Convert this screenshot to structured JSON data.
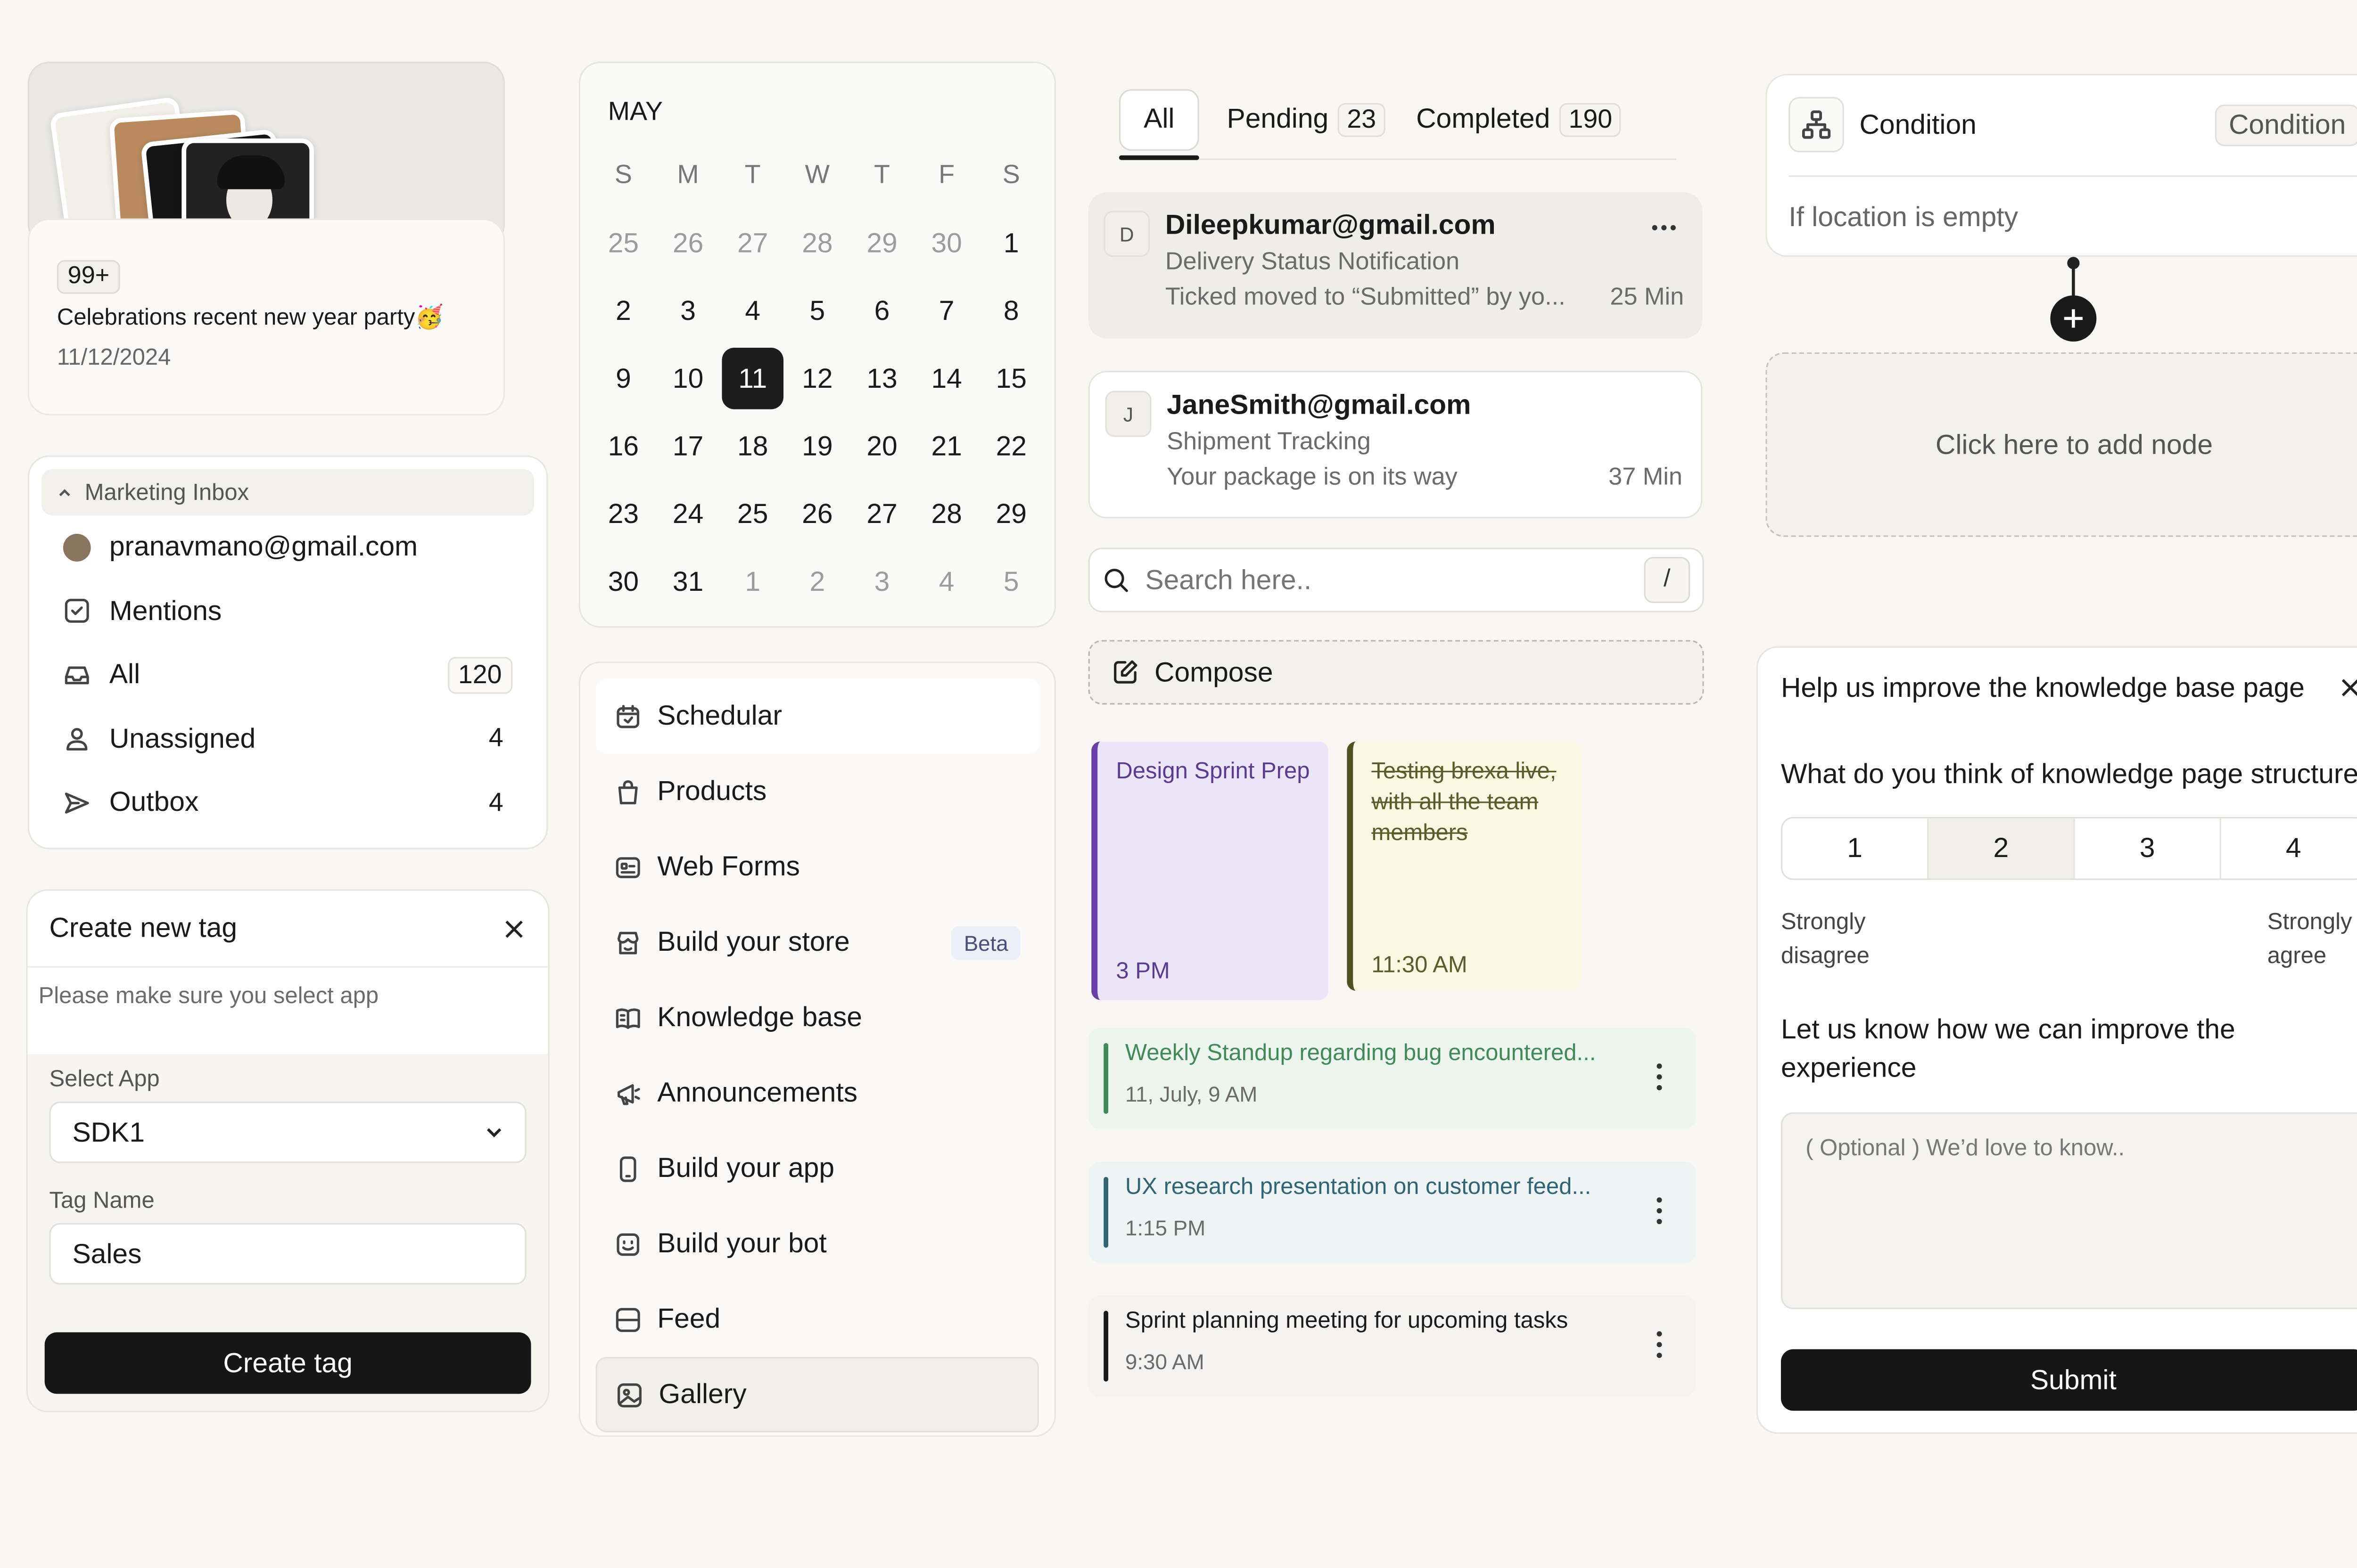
{
  "folder": {
    "badge": "99+",
    "title": "Celebrations recent new year party🥳",
    "date": "11/12/2024"
  },
  "inbox": {
    "header": "Marketing Inbox",
    "items": [
      {
        "label": "pranavmano@gmail.com",
        "count": ""
      },
      {
        "label": "Mentions",
        "count": ""
      },
      {
        "label": "All",
        "count": "120"
      },
      {
        "label": "Unassigned",
        "count": "4"
      },
      {
        "label": "Outbox",
        "count": "4"
      }
    ]
  },
  "tagform": {
    "title": "Create new tag",
    "hint": "Please make sure you select app",
    "app_label": "Select App",
    "app_value": "SDK1",
    "name_label": "Tag Name",
    "name_value": "Sales",
    "submit": "Create tag"
  },
  "calendar": {
    "month": "MAY",
    "weekdays": [
      "S",
      "M",
      "T",
      "W",
      "T",
      "F",
      "S"
    ],
    "weeks": [
      [
        "25",
        "26",
        "27",
        "28",
        "29",
        "30",
        "1"
      ],
      [
        "2",
        "3",
        "4",
        "5",
        "6",
        "7",
        "8"
      ],
      [
        "9",
        "10",
        "11",
        "12",
        "13",
        "14",
        "15"
      ],
      [
        "16",
        "17",
        "18",
        "19",
        "20",
        "21",
        "22"
      ],
      [
        "23",
        "24",
        "25",
        "26",
        "27",
        "28",
        "29"
      ],
      [
        "30",
        "31",
        "1",
        "2",
        "3",
        "4",
        "5"
      ]
    ],
    "selected": "11"
  },
  "menu": {
    "items": [
      {
        "label": "Schedular",
        "icon": "calendar-icon"
      },
      {
        "label": "Products",
        "icon": "bag-icon"
      },
      {
        "label": "Web Forms",
        "icon": "form-icon"
      },
      {
        "label": "Build your store",
        "icon": "store-icon",
        "badge": "Beta"
      },
      {
        "label": "Knowledge base",
        "icon": "book-icon"
      },
      {
        "label": "Announcements",
        "icon": "megaphone-icon"
      },
      {
        "label": "Build your app",
        "icon": "phone-icon"
      },
      {
        "label": "Build your bot",
        "icon": "bot-icon"
      },
      {
        "label": "Feed",
        "icon": "feed-icon"
      },
      {
        "label": "Gallery",
        "icon": "gallery-icon"
      }
    ]
  },
  "tabs": {
    "all": "All",
    "pending": "Pending",
    "pending_count": "23",
    "completed": "Completed",
    "completed_count": "190"
  },
  "mails": [
    {
      "avatar": "D",
      "from": "Dileepkumar@gmail.com",
      "subject": "Delivery Status Notification",
      "preview": "Ticked moved to “Submitted” by yo...",
      "time": "25 Min"
    },
    {
      "avatar": "J",
      "from": "JaneSmith@gmail.com",
      "subject": "Shipment Tracking",
      "preview": "Your package is on its way",
      "time": "37 Min"
    }
  ],
  "search": {
    "placeholder": "Search here..",
    "shortcut": "/"
  },
  "compose": {
    "label": "Compose"
  },
  "notes": [
    {
      "text": "Design Sprint Prep",
      "time": "3 PM"
    },
    {
      "text": "Testing brexa live, with all the team members",
      "time": "11:30 AM"
    }
  ],
  "events": [
    {
      "title": "Weekly Standup regarding bug encountered...",
      "time": "11, July, 9 AM",
      "color": "#3f8a57"
    },
    {
      "title": "UX research presentation on customer feed...",
      "time": "1:15 PM",
      "color": "#2f6474"
    },
    {
      "title": "Sprint planning meeting for upcoming tasks",
      "time": "9:30 AM",
      "color": "#1a1a1a"
    }
  ],
  "condition": {
    "label": "Condition",
    "pill": "Condition",
    "rule": "If location is empty",
    "add": "Click here to add node"
  },
  "feedback": {
    "title": "Help us improve the knowledge base page",
    "question1": "What do you think of knowledge page structure",
    "scale": [
      "1",
      "2",
      "3",
      "4"
    ],
    "low": "Strongly disagree",
    "high": "Strongly agree",
    "question2": "Let us know how we can improve the experience",
    "placeholder": "( Optional ) We’d love to know..",
    "submit": "Submit"
  }
}
